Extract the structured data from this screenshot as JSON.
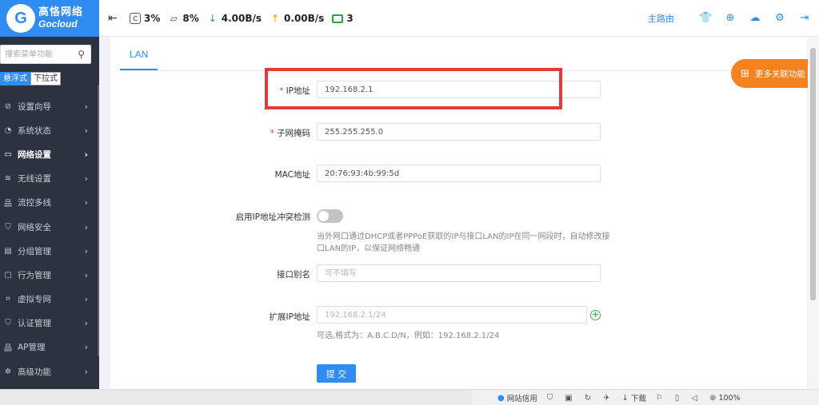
{
  "brand": {
    "name_cn": "高恪网络",
    "name_en": "Gocloud",
    "logo_letter": "G",
    "color": "#2f8cf0"
  },
  "topbar": {
    "menu_icon": "menu-collapse-icon",
    "stats": [
      {
        "name": "cpu",
        "icon": "cpu-icon",
        "glyph": "C",
        "value": "3%"
      },
      {
        "name": "memory",
        "icon": "memory-icon",
        "glyph": "▱",
        "value": "8%"
      },
      {
        "name": "download",
        "icon": "arrow-down-icon",
        "glyph": "↓",
        "value": "4.00B/s"
      },
      {
        "name": "upload",
        "icon": "arrow-up-icon",
        "glyph": "↑",
        "value": "0.00B/s"
      },
      {
        "name": "clients",
        "icon": "monitor-icon",
        "glyph": "",
        "value": "3"
      }
    ],
    "home_link": "主路由",
    "right_icons": [
      "shirt-icon",
      "globe-icon",
      "cloud-upload-icon",
      "gear-icon",
      "logout-icon"
    ]
  },
  "sidebar": {
    "search_placeholder": "搜索菜单功能",
    "modes": [
      "悬浮式",
      "下拉式"
    ],
    "active_mode": 0,
    "items": [
      {
        "label": "设置向导",
        "icon": "compass-icon",
        "glyph": "⊘"
      },
      {
        "label": "系统状态",
        "icon": "dashboard-icon",
        "glyph": "◔"
      },
      {
        "label": "网络设置",
        "icon": "monitor-icon",
        "glyph": "▭",
        "active": true
      },
      {
        "label": "无线设置",
        "icon": "wifi-icon",
        "glyph": "≋"
      },
      {
        "label": "流控多线",
        "icon": "network-icon",
        "glyph": "品"
      },
      {
        "label": "网络安全",
        "icon": "shield-icon",
        "glyph": "⛉"
      },
      {
        "label": "分组管理",
        "icon": "document-icon",
        "glyph": "▤"
      },
      {
        "label": "行为管理",
        "icon": "chat-icon",
        "glyph": "▢"
      },
      {
        "label": "虚拟专网",
        "icon": "vpn-icon",
        "glyph": "⌗"
      },
      {
        "label": "认证管理",
        "icon": "shield-check-icon",
        "glyph": "⛉"
      },
      {
        "label": "AP管理",
        "icon": "ap-icon",
        "glyph": "品"
      },
      {
        "label": "高级功能",
        "icon": "settings-icon",
        "glyph": "✲"
      }
    ]
  },
  "main": {
    "tabs": [
      "LAN"
    ],
    "form": {
      "ip": {
        "label": "IP地址",
        "required": true,
        "value": "192.168.2.1"
      },
      "mask": {
        "label": "子网掩码",
        "required": true,
        "value": "255.255.255.0"
      },
      "mac": {
        "label": "MAC地址",
        "value": "20:76:93:4b:99:5d"
      },
      "conflict": {
        "label": "启用IP地址冲突检测",
        "enabled": false,
        "hint": "当外网口通过DHCP或者PPPoE获取的IP与接口LAN的IP在同一网段时，自动修改接口LAN的IP，以保证网络畅通"
      },
      "alias": {
        "label": "接口别名",
        "value": "",
        "placeholder": "可不填写"
      },
      "ext_ip": {
        "label": "扩展IP地址",
        "value": "",
        "placeholder": "192.168.2.1/24",
        "hint": "可选,格式为：A.B.C.D/N，例如：192.168.2.1/24"
      },
      "submit": "提 交"
    },
    "more_button": "更多关联功能"
  },
  "statusbar": {
    "items": [
      {
        "icon": "water-drop-icon",
        "glyph": "💧",
        "label": "网站信用"
      },
      {
        "icon": "shield-icon",
        "glyph": "⛉",
        "label": ""
      },
      {
        "icon": "image-icon",
        "glyph": "▣",
        "label": ""
      },
      {
        "icon": "refresh-icon",
        "glyph": "↻",
        "label": ""
      },
      {
        "icon": "pin-icon",
        "glyph": "✈",
        "label": ""
      },
      {
        "icon": "download-icon",
        "glyph": "↓",
        "label": "下载"
      },
      {
        "icon": "flag-icon",
        "glyph": "⚐",
        "label": ""
      },
      {
        "icon": "book-icon",
        "glyph": "▯",
        "label": ""
      },
      {
        "icon": "speaker-icon",
        "glyph": "◁",
        "label": ""
      },
      {
        "icon": "zoom-icon",
        "glyph": "⊕",
        "label": "100%"
      }
    ]
  }
}
